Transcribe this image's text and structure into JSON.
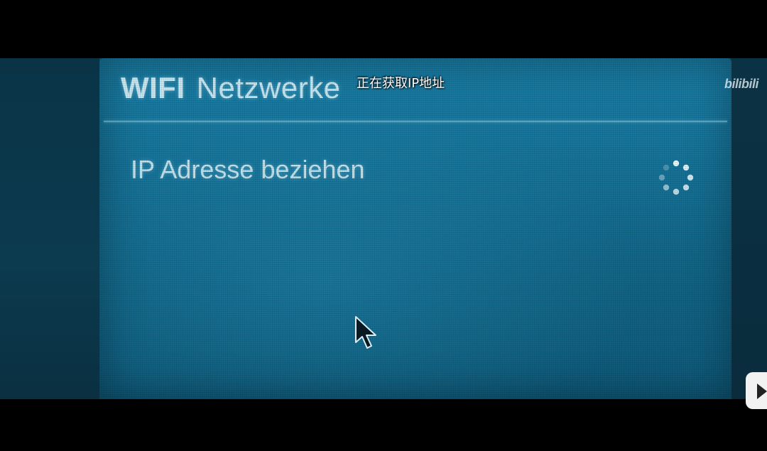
{
  "dialog": {
    "title_bold": "WIFI",
    "title_rest": "Netzwerke"
  },
  "status_item": {
    "label": "IP Adresse beziehen"
  },
  "overlay": {
    "subtitle": "正在获取IP地址",
    "watermark": "bilibili"
  },
  "icons": {
    "spinner": "loading-spinner-icon",
    "cursor": "mouse-pointer-icon",
    "play": "play-icon"
  },
  "colors": {
    "panel": "#17769c",
    "text": "#c8e6ef",
    "divider": "#96d7eb"
  }
}
